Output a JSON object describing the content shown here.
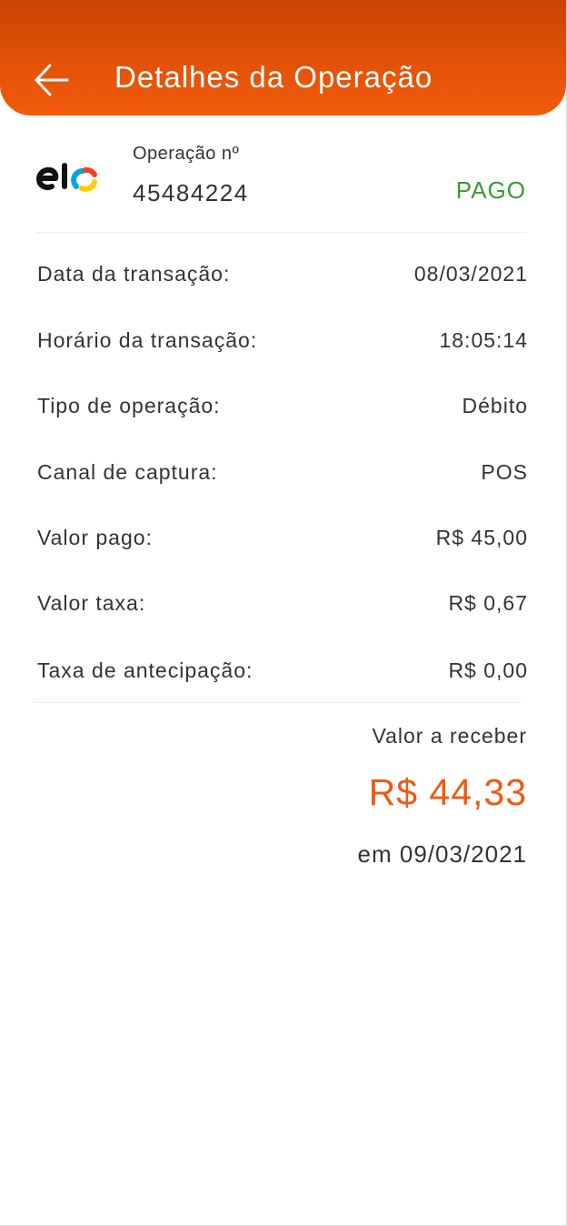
{
  "header": {
    "title": "Detalhes da Operação",
    "back_icon": "arrow-left-icon",
    "gradient_colors": [
      "#c94305",
      "#f25a0b"
    ]
  },
  "operation": {
    "brand_logo": "elo",
    "label": "Operação nº",
    "number": "45484224",
    "status": "PAGO",
    "status_color": "#3a9a35"
  },
  "details": [
    {
      "label": "Data da transação:",
      "value": "08/03/2021"
    },
    {
      "label": "Horário da transação:",
      "value": "18:05:14"
    },
    {
      "label": "Tipo de operação:",
      "value": "Débito"
    },
    {
      "label": "Canal de captura:",
      "value": "POS"
    },
    {
      "label": "Valor pago:",
      "value": "R$ 45,00"
    },
    {
      "label": "Valor taxa:",
      "value": "R$ 0,67"
    },
    {
      "label": "Taxa de antecipação:",
      "value": "R$ 0,00"
    }
  ],
  "receive": {
    "label": "Valor a receber",
    "amount": "R$ 44,33",
    "amount_color": "#ef5a14",
    "date": "em 09/03/2021"
  }
}
